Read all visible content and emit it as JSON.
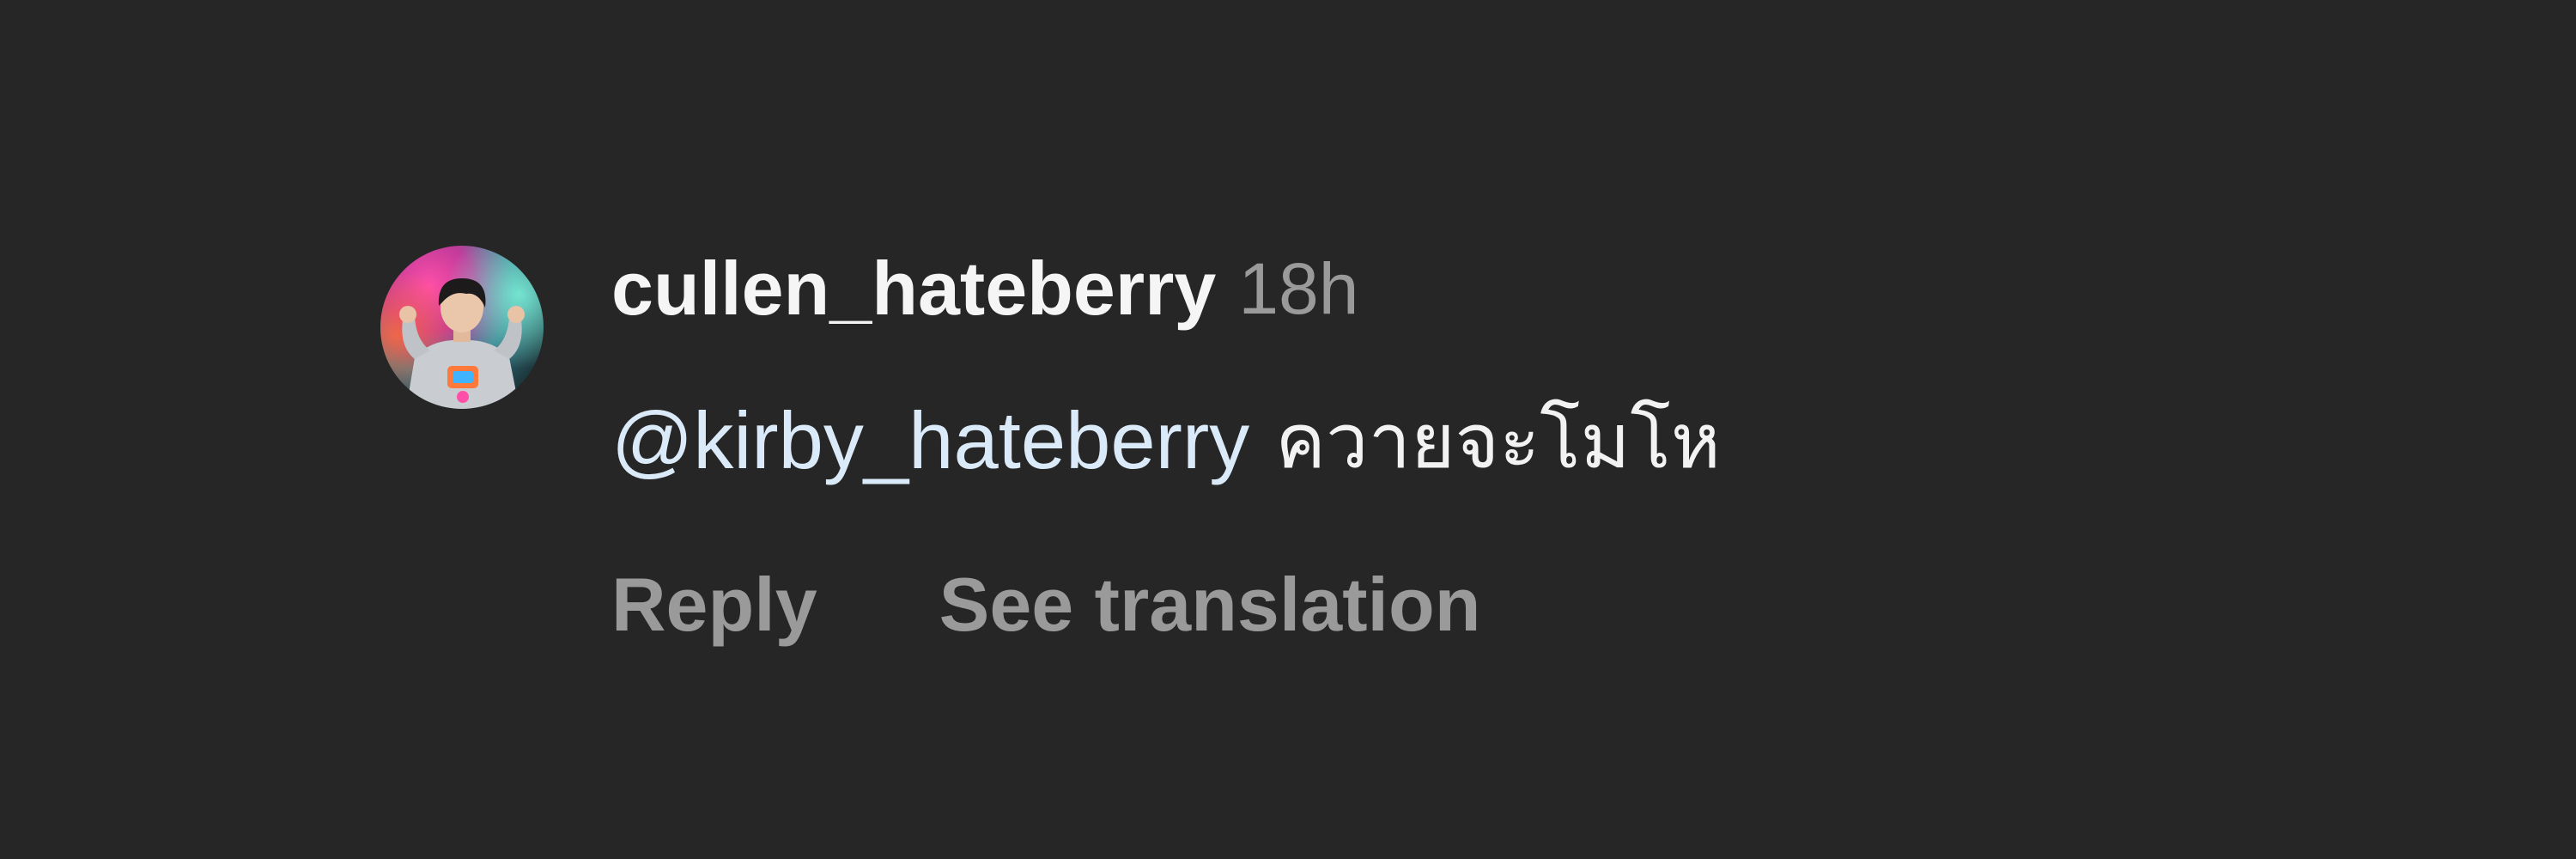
{
  "comment": {
    "avatar": {
      "icon": "user-avatar-photo"
    },
    "username": "cullen_hateberry",
    "timestamp": "18h",
    "mention": "@kirby_hateberry",
    "text": "ควายจะโมโห",
    "actions": {
      "reply_label": "Reply",
      "see_translation_label": "See translation"
    }
  },
  "colors": {
    "background": "#262626",
    "username": "#f5f5f5",
    "muted": "#9a9a9a",
    "mention": "#dbeaf8"
  }
}
